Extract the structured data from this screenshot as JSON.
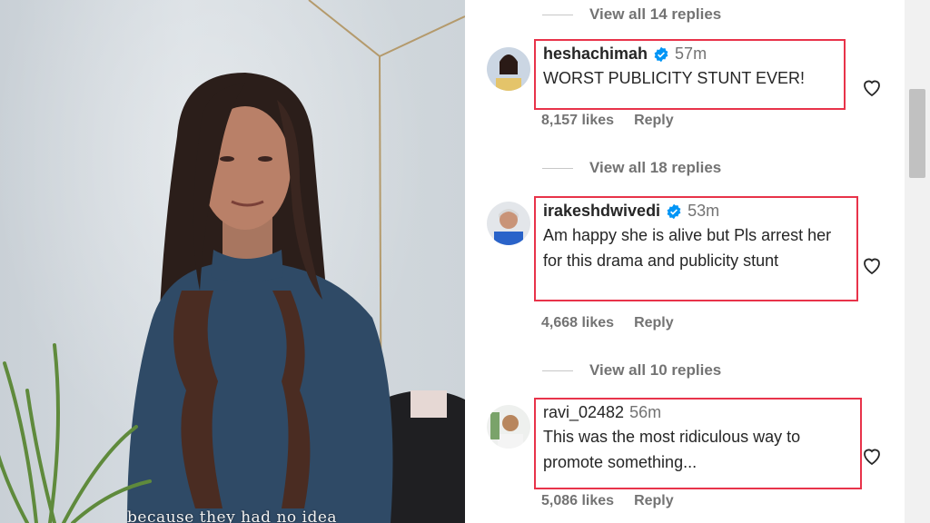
{
  "video": {
    "caption": "because they had no idea"
  },
  "comments": [
    {
      "replies_label_above": "View all 14 replies",
      "username": "heshachimah",
      "verified": true,
      "time": "57m",
      "text": "WORST PUBLICITY STUNT EVER!",
      "likes": "8,157 likes",
      "reply_label": "Reply"
    },
    {
      "replies_label_above": "View all 18 replies",
      "username": "irakeshdwivedi",
      "verified": true,
      "time": "53m",
      "text": "Am happy she is alive but Pls arrest her for this drama and publicity stunt",
      "likes": "4,668 likes",
      "reply_label": "Reply"
    },
    {
      "replies_label_above": "View all 10 replies",
      "username": "ravi_02482",
      "verified": false,
      "time": "56m",
      "text": "This was the most ridiculous way to promote something...",
      "likes": "5,086 likes",
      "reply_label": "Reply"
    }
  ],
  "icons": {
    "verified": "verified-badge-icon",
    "like": "heart-icon"
  },
  "colors": {
    "highlight_border": "#e8334a",
    "verified_blue": "#0095f6",
    "secondary_text": "#737373"
  }
}
